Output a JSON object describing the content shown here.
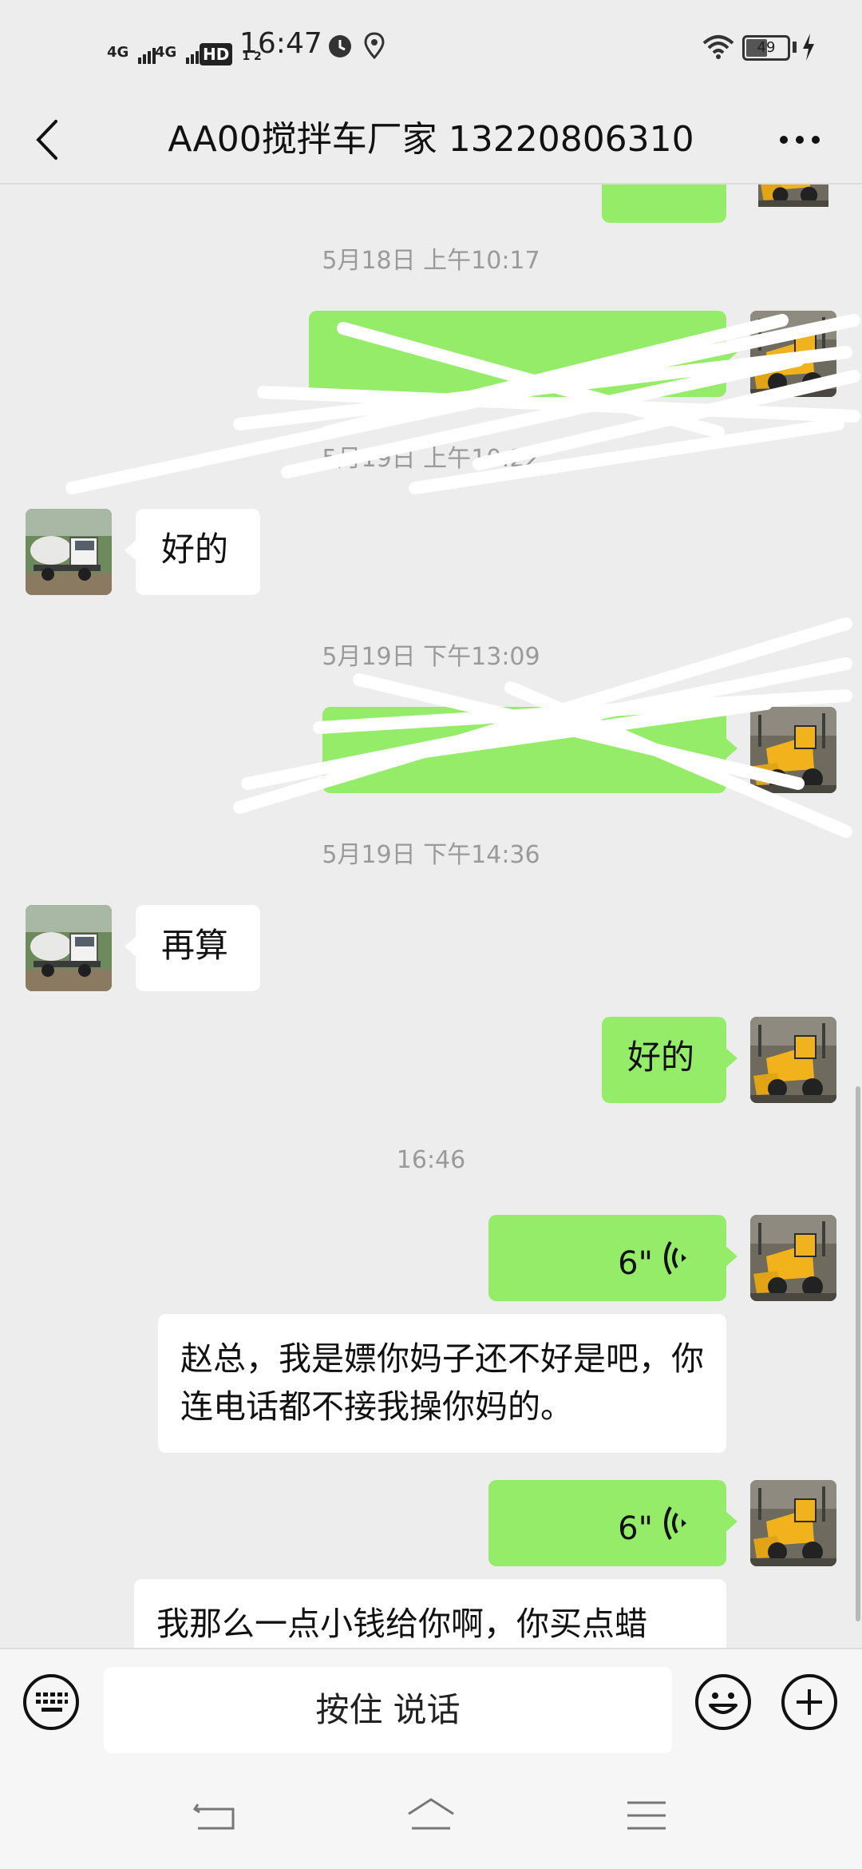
{
  "status_bar": {
    "network1": "4G",
    "network2": "4G",
    "hd_badge": "HD",
    "hd_sub": "1 2",
    "time": "16:47",
    "battery": "49",
    "icons": [
      "signal-icon",
      "hd-icon",
      "clock-app-icon",
      "location-icon",
      "wifi-icon",
      "battery-icon",
      "charging-icon"
    ]
  },
  "header": {
    "title": "AA00搅拌车厂家 13220806310",
    "icons": [
      "back-arrow-icon",
      "more-icon"
    ]
  },
  "chat": {
    "timestamps": {
      "t1": "5月18日 上午10:17",
      "t2": "5月19日 上午10:22",
      "t3": "5月19日 下午13:09",
      "t4": "5月19日 下午14:36",
      "t5": "16:46"
    },
    "messages": {
      "m_ok_in": "好的",
      "m_recalc": "再算",
      "m_ok_out": "好的",
      "voice1_duration": "6\"",
      "transcript1": "赵总，我是嫖你妈子还不好是吧，你连电话都不接我操你妈的。",
      "voice2_duration": "6\"",
      "transcript2": "我那么一点小钱给你啊，你买点蜡"
    },
    "avatars": {
      "contact": "mixer-truck-avatar",
      "self": "wheel-loader-avatar"
    }
  },
  "input_bar": {
    "hold_to_talk": "按住 说话",
    "icons": [
      "keyboard-icon",
      "emoji-icon",
      "plus-icon"
    ]
  },
  "nav_bar": {
    "icons": [
      "nav-back-icon",
      "nav-home-icon",
      "nav-menu-icon"
    ]
  },
  "colors": {
    "background": "#ededed",
    "sent_bubble": "#95ec69",
    "received_bubble": "#ffffff",
    "timestamp": "#9a9a9a"
  }
}
